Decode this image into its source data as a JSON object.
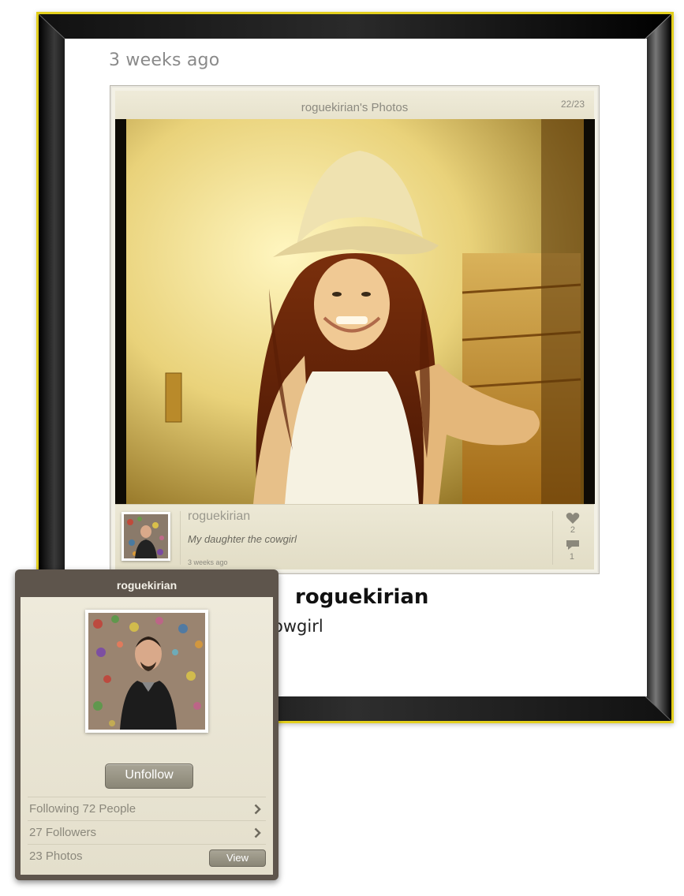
{
  "page": {
    "time_header": "3 weeks ago"
  },
  "card": {
    "title": "roguekirian's Photos",
    "counter": "22/23",
    "caption": {
      "username": "roguekirian",
      "text": "My daughter the cowgirl",
      "time": "3 weeks ago",
      "likes": "2",
      "comments": "1"
    }
  },
  "below": {
    "username": "roguekirian",
    "caption_fragment": "owgirl"
  },
  "popover": {
    "title": "roguekirian",
    "unfollow_label": "Unfollow",
    "rows": [
      {
        "label": "Following 72 People"
      },
      {
        "label": "27 Followers"
      },
      {
        "label": "23 Photos",
        "action": "View"
      }
    ]
  },
  "colors": {
    "frame_border": "#e3cf1d",
    "popover_header": "#5e554c",
    "paper": "#eeeadb"
  },
  "icons": [
    "heart-icon",
    "comment-icon",
    "chevron-right-icon"
  ]
}
